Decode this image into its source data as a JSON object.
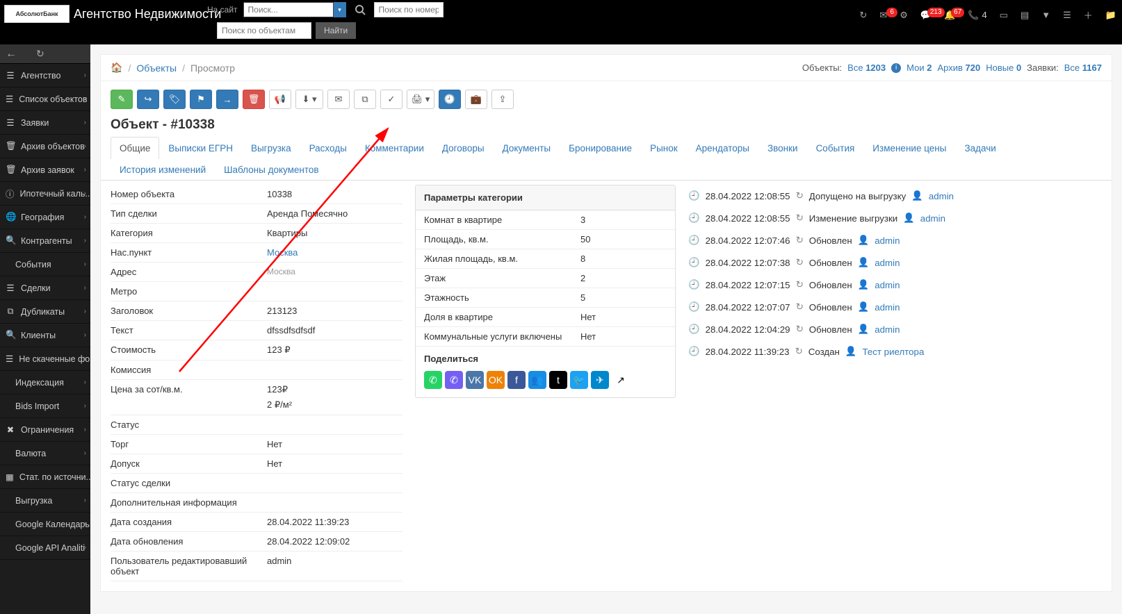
{
  "header": {
    "app_title": "Агентство Недвижимости",
    "logo_text": "АбсолютБанк",
    "top_label": "На сайт",
    "search_placeholder": "Поиск...",
    "number_search_placeholder": "Поиск по номеру...",
    "object_search_placeholder": "Поиск по объектам",
    "find_label": "Найти",
    "mail_badge": "6",
    "chat_badge": "213",
    "bell_badge": "67",
    "phone_count": "4"
  },
  "sidebar": {
    "items": [
      {
        "icon": "bars",
        "label": "Агентство"
      },
      {
        "icon": "bars",
        "label": "Список объектов"
      },
      {
        "icon": "bars",
        "label": "Заявки"
      },
      {
        "icon": "trash",
        "label": "Архив объектов"
      },
      {
        "icon": "trash",
        "label": "Архив заявок"
      },
      {
        "icon": "info",
        "label": "Ипотечный каль..."
      },
      {
        "icon": "globe",
        "label": "География"
      },
      {
        "icon": "search",
        "label": "Контрагенты"
      },
      {
        "icon": "",
        "label": "События",
        "child": true
      },
      {
        "icon": "bars",
        "label": "Сделки"
      },
      {
        "icon": "copy",
        "label": "Дубликаты"
      },
      {
        "icon": "search",
        "label": "Клиенты"
      },
      {
        "icon": "bars",
        "label": "Не скаченные фо..."
      },
      {
        "icon": "",
        "label": "Индексация",
        "child": true
      },
      {
        "icon": "",
        "label": "Bids Import",
        "child": true
      },
      {
        "icon": "x",
        "label": "Ограничения"
      },
      {
        "icon": "",
        "label": "Валюта",
        "child": true
      },
      {
        "icon": "grid",
        "label": "Стат. по источни..."
      },
      {
        "icon": "",
        "label": "Выгрузка",
        "child": true
      },
      {
        "icon": "",
        "label": "Google Календарь",
        "child": true
      },
      {
        "icon": "",
        "label": "Google API Analiti",
        "child": true
      }
    ]
  },
  "breadcrumb": {
    "objects": "Объекты",
    "view": "Просмотр"
  },
  "counts": {
    "label_objects": "Объекты:",
    "all": "Все",
    "all_n": "1203",
    "mine": "Мои",
    "mine_n": "2",
    "archive": "Архив",
    "archive_n": "720",
    "new": "Новые",
    "new_n": "0",
    "label_req": "Заявки:",
    "req_all": "Все",
    "req_all_n": "1167"
  },
  "object": {
    "title": "Объект - #10338",
    "tabs": [
      "Общие",
      "Выписки ЕГРН",
      "Выгрузка",
      "Расходы",
      "Комментарии",
      "Договоры",
      "Документы",
      "Бронирование",
      "Рынок",
      "Арендаторы",
      "Звонки",
      "События",
      "Изменение цены",
      "Задачи",
      "История изменений",
      "Шаблоны документов"
    ]
  },
  "fields": {
    "number_k": "Номер объекта",
    "number_v": "10338",
    "deal_k": "Тип сделки",
    "deal_v": "Аренда Помесячно",
    "cat_k": "Категория",
    "cat_v": "Квартиры",
    "city_k": "Нас.пункт",
    "city_v": "Москва",
    "addr_k": "Адрес",
    "addr_v": "Москва",
    "metro_k": "Метро",
    "metro_v": "",
    "title_k": "Заголовок",
    "title_v": "213123",
    "text_k": "Текст",
    "text_v": "dfssdfsdfsdf",
    "price_k": "Стоимость",
    "price_v": "123",
    "comm_k": "Комиссия",
    "comm_v": "",
    "ppm_k": "Цена за сот/кв.м.",
    "ppm_v1": "123",
    "ppm_v2": "2",
    "ppm_unit": "/м²",
    "status_k": "Статус",
    "status_v": "",
    "torg_k": "Торг",
    "torg_v": "Нет",
    "allow_k": "Допуск",
    "allow_v": "Нет",
    "dealst_k": "Статус сделки",
    "dealst_v": "",
    "extra_k": "Дополнительная информация",
    "extra_v": "",
    "created_k": "Дата создания",
    "created_v": "28.04.2022 11:39:23",
    "updated_k": "Дата обновления",
    "updated_v": "28.04.2022 12:09:02",
    "editor_k": "Пользователь редактировавший объект",
    "editor_v": "admin"
  },
  "params": {
    "panel_title": "Параметры категории",
    "rows": [
      {
        "k": "Комнат в квартире",
        "v": "3"
      },
      {
        "k": "Площадь, кв.м.",
        "v": "50"
      },
      {
        "k": "Жилая площадь, кв.м.",
        "v": "8"
      },
      {
        "k": "Этаж",
        "v": "2"
      },
      {
        "k": "Этажность",
        "v": "5"
      },
      {
        "k": "Доля в квартире",
        "v": "Нет"
      },
      {
        "k": "Коммунальные услуги включены",
        "v": "Нет"
      }
    ],
    "share_title": "Поделиться"
  },
  "log": [
    {
      "t": "28.04.2022 12:08:55",
      "a": "Допущено на выгрузку",
      "u": "admin"
    },
    {
      "t": "28.04.2022 12:08:55",
      "a": "Изменение выгрузки",
      "u": "admin"
    },
    {
      "t": "28.04.2022 12:07:46",
      "a": "Обновлен",
      "u": "admin"
    },
    {
      "t": "28.04.2022 12:07:38",
      "a": "Обновлен",
      "u": "admin"
    },
    {
      "t": "28.04.2022 12:07:15",
      "a": "Обновлен",
      "u": "admin"
    },
    {
      "t": "28.04.2022 12:07:07",
      "a": "Обновлен",
      "u": "admin"
    },
    {
      "t": "28.04.2022 12:04:29",
      "a": "Обновлен",
      "u": "admin"
    },
    {
      "t": "28.04.2022 11:39:23",
      "a": "Создан",
      "u": "Тест риелтора"
    }
  ],
  "share_colors": [
    "#25d366",
    "#7360f2",
    "#4a76a8",
    "#ee8208",
    "#3b5998",
    "#168de2",
    "#000",
    "#1da1f2",
    "#0088cc",
    "#000"
  ]
}
